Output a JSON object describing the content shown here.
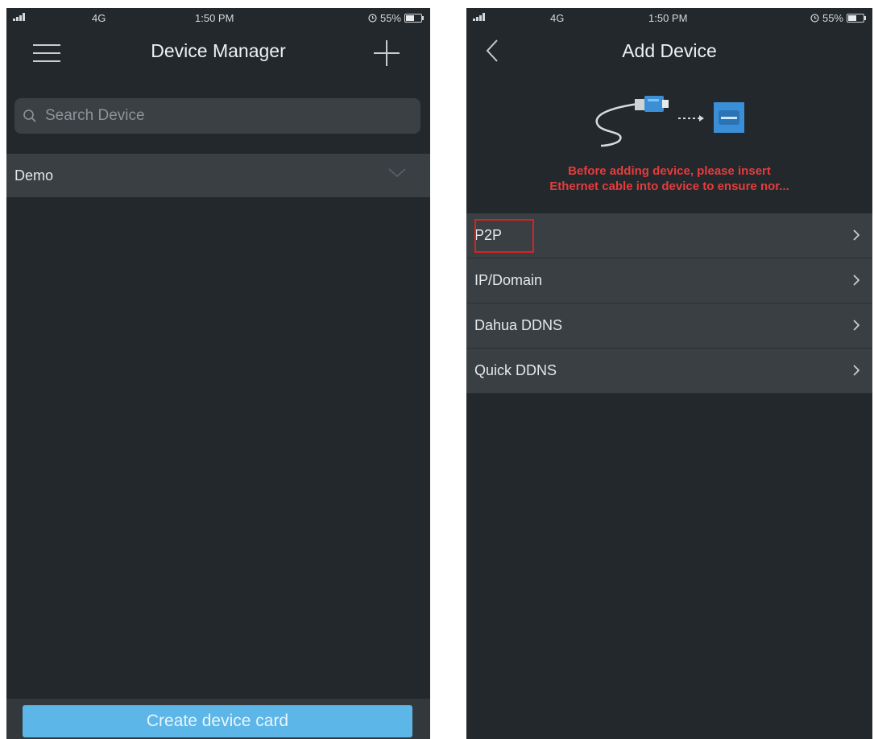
{
  "left_screen": {
    "status": {
      "network": "4G",
      "time": "1:50 PM",
      "battery": "55%",
      "battery_level": 0.55
    },
    "title": "Device Manager",
    "search": {
      "placeholder": "Search Device"
    },
    "group": {
      "label": "Demo"
    },
    "create_button": "Create device card"
  },
  "right_screen": {
    "status": {
      "network": "4G",
      "time": "1:50 PM",
      "battery": "55%",
      "battery_level": 0.55
    },
    "title": "Add Device",
    "warning": {
      "line1": "Before adding device, please insert",
      "line2": "Ethernet cable into device to ensure nor..."
    },
    "methods": [
      {
        "label": "P2P"
      },
      {
        "label": "IP/Domain"
      },
      {
        "label": "Dahua DDNS"
      },
      {
        "label": "Quick DDNS"
      }
    ]
  },
  "colors": {
    "background": "#23282c",
    "row": "#3a3f44",
    "accent_button": "#5cb6e8",
    "warning_text": "#e53c3c",
    "highlight_box": "#e02020"
  },
  "icons": [
    "signal-icon",
    "menu-icon",
    "plus-icon",
    "search-icon",
    "chevron-down-icon",
    "back-arrow-icon",
    "ethernet-cable-icon",
    "ethernet-port-icon",
    "chevron-right-icon",
    "alarm-icon"
  ]
}
